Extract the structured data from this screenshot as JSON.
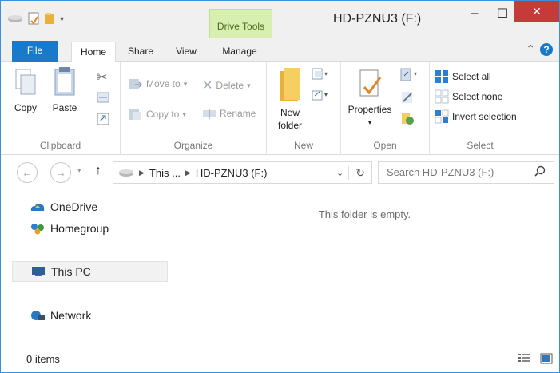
{
  "window": {
    "title": "HD-PZNU3 (F:)",
    "context_tab": "Drive Tools",
    "buttons": {
      "minimize": "–",
      "maximize": "☐",
      "close": "✕"
    }
  },
  "ribbon_tabs": {
    "file": "File",
    "home": "Home",
    "share": "Share",
    "view": "View",
    "manage": "Manage"
  },
  "ribbon": {
    "clipboard": {
      "label": "Clipboard",
      "copy": "Copy",
      "paste": "Paste"
    },
    "organize": {
      "label": "Organize",
      "move_to": "Move to",
      "copy_to": "Copy to",
      "delete": "Delete",
      "rename": "Rename"
    },
    "new": {
      "label": "New",
      "new_folder_line1": "New",
      "new_folder_line2": "folder"
    },
    "open": {
      "label": "Open",
      "properties": "Properties"
    },
    "select": {
      "label": "Select",
      "select_all": "Select all",
      "select_none": "Select none",
      "invert_selection": "Invert selection"
    }
  },
  "address": {
    "path_root": "This ...",
    "path_current": "HD-PZNU3 (F:)",
    "search_placeholder": "Search HD-PZNU3 (F:)"
  },
  "nav_pane": {
    "onedrive": "OneDrive",
    "homegroup": "Homegroup",
    "this_pc": "This PC",
    "network": "Network"
  },
  "content": {
    "empty_message": "This folder is empty."
  },
  "status": {
    "items": "0 items"
  },
  "colors": {
    "accent": "#1979ca",
    "close": "#c73a3a",
    "context_tab": "#d7efb0"
  }
}
